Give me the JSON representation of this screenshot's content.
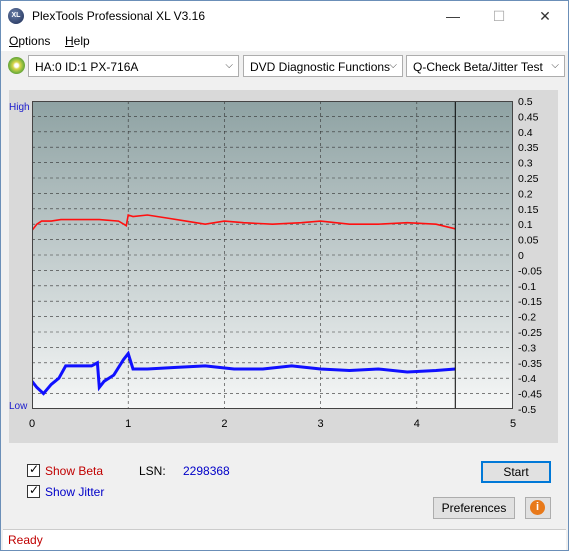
{
  "window": {
    "title": "PlexTools Professional XL V3.16",
    "icon_text": "XL"
  },
  "controls": {
    "minimize": "—",
    "maximize": "☐",
    "close": "✕"
  },
  "menu": [
    {
      "label_u": "O",
      "label_rest": "ptions"
    },
    {
      "label_u": "H",
      "label_rest": "elp"
    }
  ],
  "toolbar": {
    "drive": "HA:0 ID:1  PX-716A",
    "function": "DVD Diagnostic Functions",
    "test": "Q-Check Beta/Jitter Test",
    "arrow": "⌵"
  },
  "chart": {
    "left_top_label": "High",
    "left_bottom_label": "Low",
    "x_ticks": [
      "0",
      "1",
      "2",
      "3",
      "4",
      "5"
    ],
    "y_ticks": [
      "0.5",
      "0.45",
      "0.4",
      "0.35",
      "0.3",
      "0.25",
      "0.2",
      "0.15",
      "0.1",
      "0.05",
      "0",
      "-0.05",
      "-0.1",
      "-0.15",
      "-0.2",
      "-0.25",
      "-0.3",
      "-0.35",
      "-0.4",
      "-0.45",
      "-0.5"
    ]
  },
  "chart_data": {
    "type": "line",
    "xlim": [
      0,
      5
    ],
    "ylim": [
      -0.5,
      0.5
    ],
    "end_marker_x": 4.4,
    "series": [
      {
        "color": "#ff1010",
        "x": [
          0,
          0.05,
          0.1,
          0.2,
          0.3,
          0.5,
          0.7,
          0.9,
          0.98,
          1.0,
          1.05,
          1.2,
          1.4,
          1.6,
          1.8,
          2.0,
          2.2,
          2.5,
          2.8,
          3.0,
          3.3,
          3.6,
          3.9,
          4.2,
          4.4
        ],
        "y": [
          0.08,
          0.1,
          0.11,
          0.11,
          0.115,
          0.115,
          0.115,
          0.11,
          0.095,
          0.13,
          0.125,
          0.13,
          0.12,
          0.11,
          0.1,
          0.11,
          0.105,
          0.1,
          0.105,
          0.11,
          0.1,
          0.1,
          0.105,
          0.1,
          0.085
        ]
      },
      {
        "color": "#1010ff",
        "x": [
          0,
          0.05,
          0.12,
          0.2,
          0.28,
          0.35,
          0.45,
          0.55,
          0.62,
          0.68,
          0.7,
          0.75,
          0.85,
          0.95,
          1.0,
          1.05,
          1.2,
          1.5,
          1.8,
          2.1,
          2.4,
          2.7,
          3.0,
          3.3,
          3.6,
          3.9,
          4.2,
          4.4
        ],
        "y": [
          -0.41,
          -0.43,
          -0.45,
          -0.42,
          -0.4,
          -0.36,
          -0.36,
          -0.36,
          -0.36,
          -0.35,
          -0.43,
          -0.41,
          -0.39,
          -0.34,
          -0.32,
          -0.37,
          -0.37,
          -0.365,
          -0.36,
          -0.37,
          -0.37,
          -0.36,
          -0.37,
          -0.375,
          -0.37,
          -0.38,
          -0.375,
          -0.37
        ]
      }
    ]
  },
  "options": {
    "show_beta_label": "Show Beta",
    "show_jitter_label": "Show Jitter",
    "lsn_label": "LSN:",
    "lsn_value": "2298368"
  },
  "buttons": {
    "start": "Start",
    "preferences": "Preferences",
    "info": "i"
  },
  "status": {
    "text": "Ready"
  }
}
